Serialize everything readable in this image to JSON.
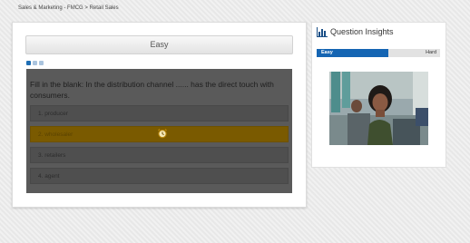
{
  "breadcrumb": {
    "category": "Sales & Marketing",
    "subcategory": "FMCG",
    "topic": "Retail Sales",
    "sep1": "-",
    "sep2": ">"
  },
  "question": {
    "level": "Easy",
    "pagination": {
      "total": 3,
      "current": 1
    },
    "text": "Fill in the blank: In the distribution channel ...... has the direct touch with consumers.",
    "options": [
      "1. producer",
      "2. wholesaler",
      "3. retailers",
      "4. agent"
    ],
    "selected_option": 2,
    "icons": {
      "timer": "alarm-clock-icon",
      "insights": "bar-chart-icon"
    }
  },
  "insights": {
    "title": "Question Insights",
    "difficulty": {
      "easy_label": "Easy",
      "hard_label": "Hard",
      "level": 0.58,
      "fill_color": "#1565b3"
    }
  },
  "colors": {
    "accent": "#1565b3",
    "selected_option": "#7a5a00",
    "overlay": "#5a5a5a"
  }
}
